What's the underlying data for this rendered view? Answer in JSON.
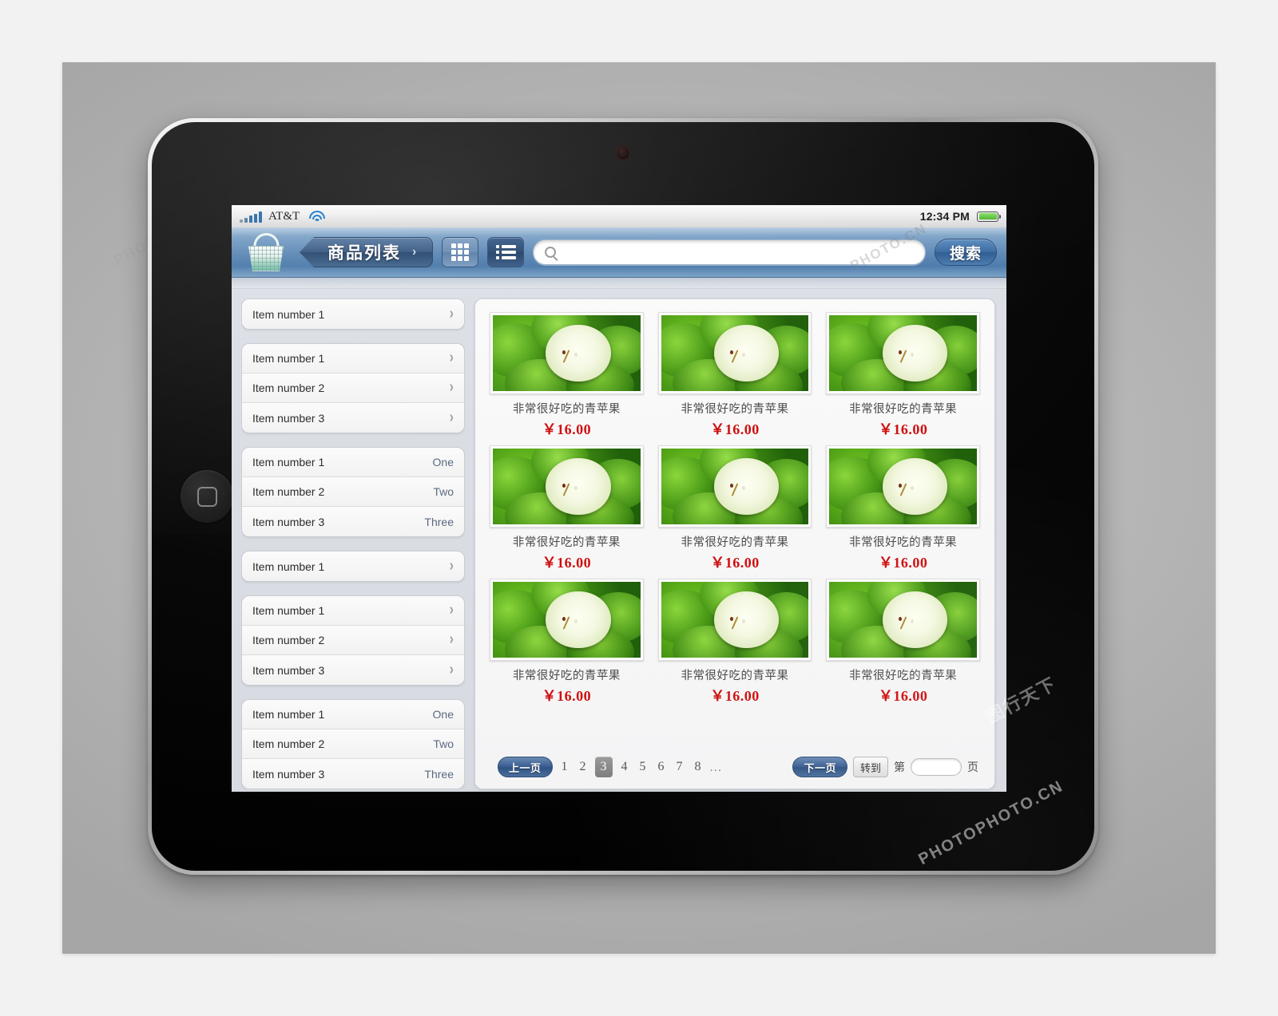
{
  "status_bar": {
    "carrier": "AT&T",
    "signal_icon": "signal-bars-icon",
    "wifi_icon": "wifi-icon",
    "time": "12:34 PM",
    "battery_icon": "battery-icon"
  },
  "toolbar": {
    "logo_icon": "shopping-basket-icon",
    "title": "商品列表",
    "title_arrow": "›",
    "grid_view_icon": "grid-view-icon",
    "list_view_icon": "list-view-icon",
    "search": {
      "icon": "search-icon",
      "value": "",
      "placeholder": ""
    },
    "search_button": "搜索"
  },
  "sidebar": {
    "groups": [
      {
        "items": [
          {
            "label": "Item number 1",
            "value": "",
            "accessory": "chevron-right"
          }
        ]
      },
      {
        "items": [
          {
            "label": "Item number 1",
            "value": "",
            "accessory": "chevron-right"
          },
          {
            "label": "Item number 2",
            "value": "",
            "accessory": "chevron-right"
          },
          {
            "label": "Item number 3",
            "value": "",
            "accessory": "chevron-right"
          }
        ]
      },
      {
        "items": [
          {
            "label": "Item number 1",
            "value": "One",
            "accessory": ""
          },
          {
            "label": "Item number 2",
            "value": "Two",
            "accessory": ""
          },
          {
            "label": "Item number 3",
            "value": "Three",
            "accessory": ""
          }
        ]
      },
      {
        "items": [
          {
            "label": "Item number 1",
            "value": "",
            "accessory": "chevron-right"
          }
        ]
      },
      {
        "items": [
          {
            "label": "Item number 1",
            "value": "",
            "accessory": "chevron-right"
          },
          {
            "label": "Item number 2",
            "value": "",
            "accessory": "chevron-right"
          },
          {
            "label": "Item number 3",
            "value": "",
            "accessory": "chevron-right"
          }
        ]
      },
      {
        "items": [
          {
            "label": "Item number 1",
            "value": "One",
            "accessory": ""
          },
          {
            "label": "Item number 2",
            "value": "Two",
            "accessory": ""
          },
          {
            "label": "Item number 3",
            "value": "Three",
            "accessory": ""
          }
        ]
      }
    ]
  },
  "products": [
    {
      "name": "非常很好吃的青苹果",
      "price": "￥16.00",
      "image": "green-apples-photo"
    },
    {
      "name": "非常很好吃的青苹果",
      "price": "￥16.00",
      "image": "green-apples-photo"
    },
    {
      "name": "非常很好吃的青苹果",
      "price": "￥16.00",
      "image": "green-apples-photo"
    },
    {
      "name": "非常很好吃的青苹果",
      "price": "￥16.00",
      "image": "green-apples-photo"
    },
    {
      "name": "非常很好吃的青苹果",
      "price": "￥16.00",
      "image": "green-apples-photo"
    },
    {
      "name": "非常很好吃的青苹果",
      "price": "￥16.00",
      "image": "green-apples-photo"
    },
    {
      "name": "非常很好吃的青苹果",
      "price": "￥16.00",
      "image": "green-apples-photo"
    },
    {
      "name": "非常很好吃的青苹果",
      "price": "￥16.00",
      "image": "green-apples-photo"
    },
    {
      "name": "非常很好吃的青苹果",
      "price": "￥16.00",
      "image": "green-apples-photo"
    }
  ],
  "pagination": {
    "prev_label": "上一页",
    "next_label": "下一页",
    "pages": [
      "1",
      "2",
      "3",
      "4",
      "5",
      "6",
      "7",
      "8"
    ],
    "active_page": "3",
    "ellipsis": "...",
    "goto_button": "转到",
    "goto_prefix": "第",
    "goto_suffix": "页",
    "goto_value": ""
  },
  "colors": {
    "toolbar_blue": "#4d7bab",
    "title_tab": "#2c4a70",
    "price_red": "#cf1010",
    "active_page_gray": "#8a8a8a",
    "list_value_blue": "#5a6a80"
  },
  "watermarks": {
    "w1": "PHOTO.CN",
    "w2": "图行天下",
    "w3": "PHOTOPHOTO.CN",
    "w4": "PHOTO",
    "w5": "PHOTOPHOTO"
  }
}
